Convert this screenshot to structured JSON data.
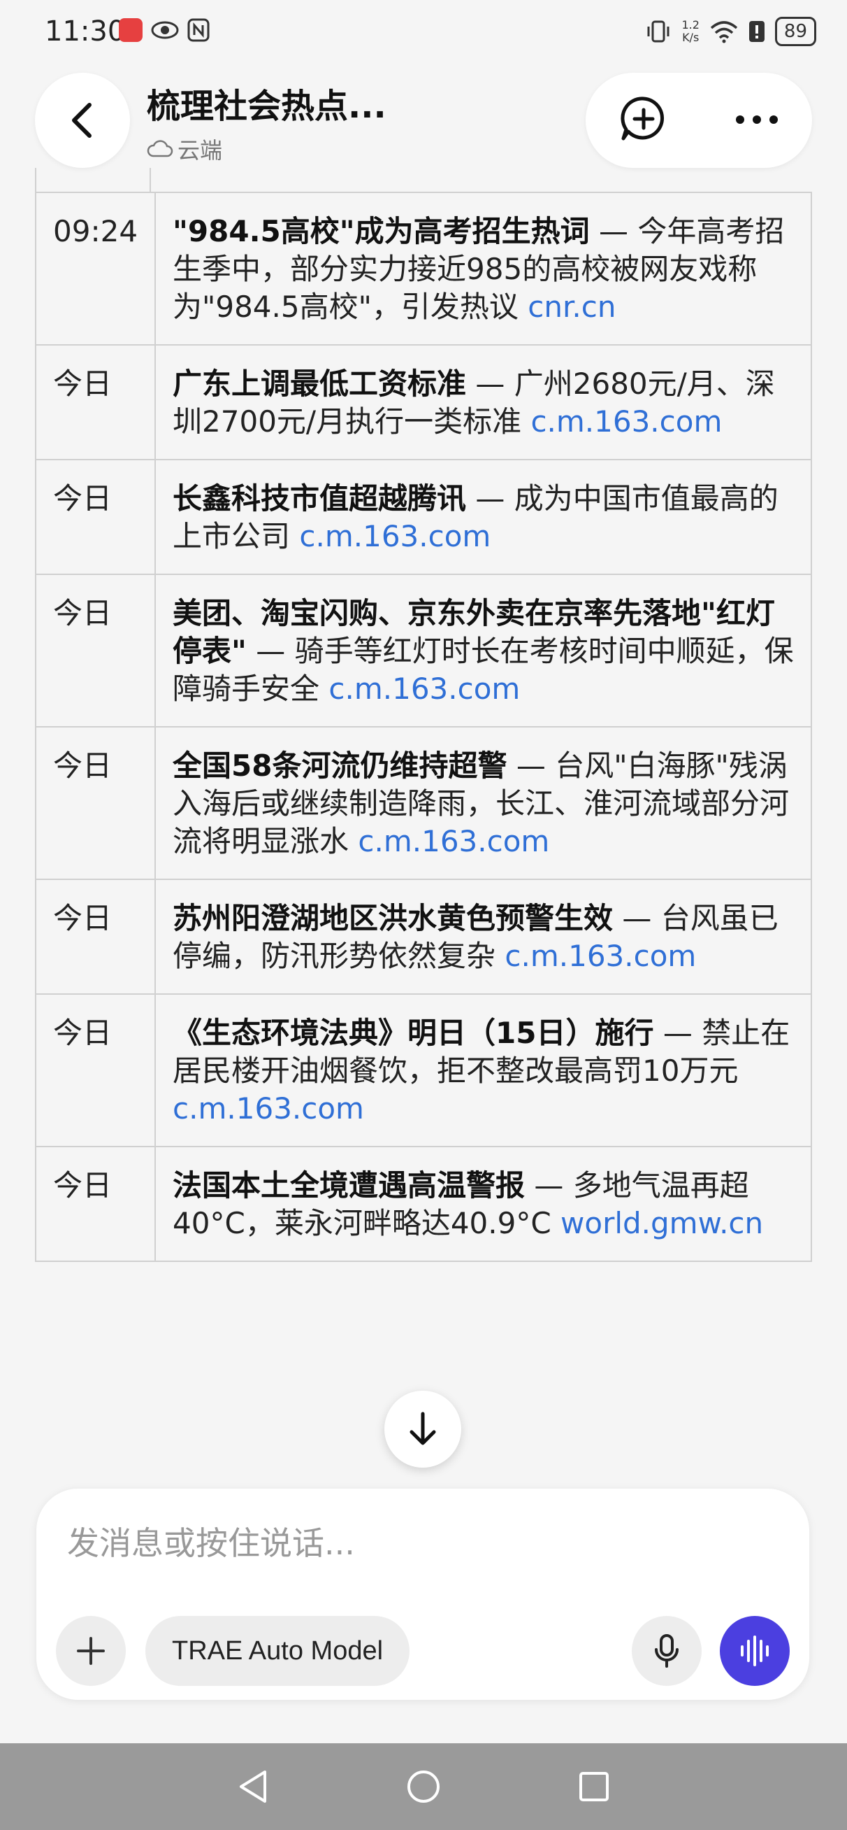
{
  "status_bar": {
    "time": "11:30",
    "net_speed_value": "1.2",
    "net_speed_unit": "K/s",
    "battery": "89"
  },
  "header": {
    "title": "梳理社会热点...",
    "location_label": "云端"
  },
  "news_rows": [
    {
      "time": "09:24",
      "headline": "\"984.5高校\"成为高考招生热词",
      "desc": " — 今年高考招生季中，部分实力接近985的高校被网友戏称为\"984.5高校\"，引发热议 ",
      "link": "cnr.cn"
    },
    {
      "time": "今日",
      "headline": "广东上调最低工资标准",
      "desc": " — 广州2680元/月、深圳2700元/月执行一类标准 ",
      "link": "c.m.163.com"
    },
    {
      "time": "今日",
      "headline": "长鑫科技市值超越腾讯",
      "desc": " — 成为中国市值最高的上市公司 ",
      "link": "c.m.163.com"
    },
    {
      "time": "今日",
      "headline": "美团、淘宝闪购、京东外卖在京率先落地\"红灯停表\"",
      "desc": " — 骑手等红灯时长在考核时间中顺延，保障骑手安全 ",
      "link": "c.m.163.com"
    },
    {
      "time": "今日",
      "headline": "全国58条河流仍维持超警",
      "desc": " — 台风\"白海豚\"残涡入海后或继续制造降雨，长江、淮河流域部分河流将明显涨水 ",
      "link": "c.m.163.com"
    },
    {
      "time": "今日",
      "headline": "苏州阳澄湖地区洪水黄色预警生效",
      "desc": " — 台风虽已停编，防汛形势依然复杂 ",
      "link": "c.m.163.com"
    },
    {
      "time": "今日",
      "headline": "《生态环境法典》明日（15日）施行",
      "desc": " — 禁止在居民楼开油烟餐饮，拒不整改最高罚10万元 ",
      "link": "c.m.163.com"
    },
    {
      "time": "今日",
      "headline": "法国本土全境遭遇高温警报",
      "desc": " — 多地气温再超40°C，莱永河畔略达40.9°C ",
      "link": "world.gmw.cn"
    }
  ],
  "composer": {
    "placeholder": "发消息或按住说话...",
    "model_label": "TRAE Auto Model"
  },
  "colors": {
    "link": "#2f6fd6",
    "voice_button": "#4b3fe0",
    "nav_bar": "#9a9a9a"
  },
  "icons": [
    "back-arrow-icon",
    "add-chat-icon",
    "more-icon",
    "cloud-icon",
    "arrow-down-icon",
    "plus-icon",
    "mic-icon",
    "voice-wave-icon",
    "nav-back-icon",
    "nav-home-icon",
    "nav-recent-icon"
  ]
}
